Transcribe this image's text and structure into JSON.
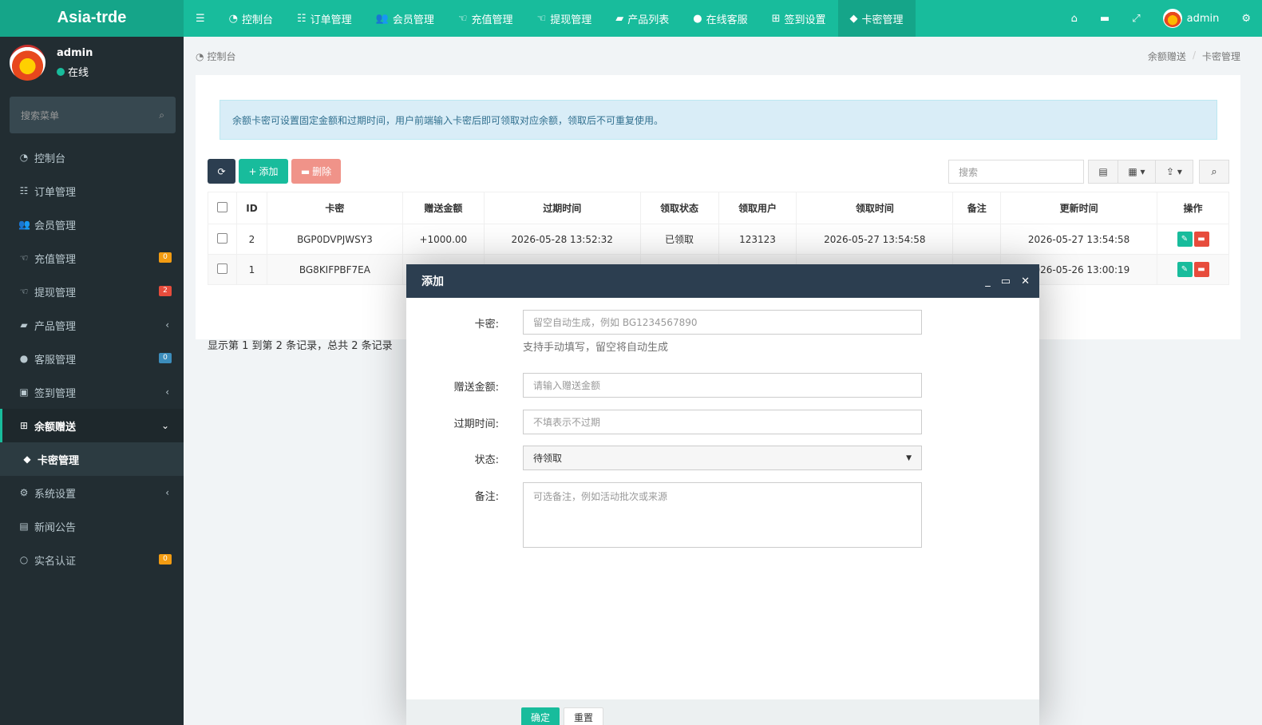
{
  "header": {
    "logo": "Asia-trde",
    "menu_icon": "bars-icon",
    "nav": [
      {
        "label": "控制台",
        "icon": "dashboard-icon"
      },
      {
        "label": "订单管理",
        "icon": "list-icon"
      },
      {
        "label": "会员管理",
        "icon": "users-icon"
      },
      {
        "label": "充值管理",
        "icon": "hand-icon"
      },
      {
        "label": "提现管理",
        "icon": "hand-icon"
      },
      {
        "label": "产品列表",
        "icon": "briefcase-icon"
      },
      {
        "label": "在线客服",
        "icon": "comment-icon"
      },
      {
        "label": "签到设置",
        "icon": "gift-icon"
      },
      {
        "label": "卡密管理",
        "icon": "tag-icon"
      }
    ],
    "right": {
      "username": "admin"
    }
  },
  "sidebar": {
    "user": {
      "name": "admin",
      "status": "在线"
    },
    "search_placeholder": "搜索菜单",
    "items": [
      {
        "label": "控制台",
        "icon": "dashboard-icon"
      },
      {
        "label": "订单管理",
        "icon": "list-icon"
      },
      {
        "label": "会员管理",
        "icon": "users-icon"
      },
      {
        "label": "充值管理",
        "icon": "hand-icon",
        "badge": "0",
        "badge_color": "#f39c12"
      },
      {
        "label": "提现管理",
        "icon": "hand-icon",
        "badge": "2",
        "badge_color": "#e74c3c"
      },
      {
        "label": "产品管理",
        "icon": "briefcase-icon",
        "arrow": "‹"
      },
      {
        "label": "客服管理",
        "icon": "comment-icon",
        "badge": "0",
        "badge_color": "#3c8dbc"
      },
      {
        "label": "签到管理",
        "icon": "calendar-icon",
        "arrow": "‹"
      },
      {
        "label": "余额赠送",
        "icon": "gift-icon",
        "arrow": "⌄"
      },
      {
        "label": "卡密管理",
        "icon": "tag-icon"
      },
      {
        "label": "系统设置",
        "icon": "cogs-icon",
        "arrow": "‹"
      },
      {
        "label": "新闻公告",
        "icon": "newspaper-icon"
      },
      {
        "label": "实名认证",
        "icon": "circle-icon",
        "badge": "0",
        "badge_color": "#f39c12"
      }
    ]
  },
  "breadcrumb": {
    "left": "控制台",
    "right": [
      "余额赠送",
      "/",
      "卡密管理"
    ]
  },
  "alert": "余额卡密可设置固定金额和过期时间，用户前端输入卡密后即可领取对应余额，领取后不可重复使用。",
  "toolbar": {
    "add": "添加",
    "delete": "删除",
    "search_placeholder": "搜索"
  },
  "table": {
    "headers": [
      "ID",
      "卡密",
      "赠送金额",
      "过期时间",
      "领取状态",
      "领取用户",
      "领取时间",
      "备注",
      "更新时间",
      "操作"
    ],
    "rows": [
      [
        "2",
        "BGP0DVPJWSY3",
        "+1000.00",
        "2026-05-28 13:52:32",
        "已领取",
        "123123",
        "2026-05-27 13:54:58",
        "",
        "2026-05-27 13:54:58"
      ],
      [
        "1",
        "BG8KIFPBF7EA",
        "",
        "",
        "",
        "",
        "",
        "",
        "2026-05-26 13:00:19"
      ]
    ]
  },
  "pagination": "显示第 1 到第 2 条记录，总共 2 条记录",
  "modal": {
    "title": "添加",
    "fields": {
      "card_label": "卡密:",
      "card_placeholder": "留空自动生成，例如 BG1234567890",
      "card_help": "支持手动填写，留空将自动生成",
      "amount_label": "赠送金额:",
      "amount_placeholder": "请输入赠送金额",
      "expire_label": "过期时间:",
      "expire_placeholder": "不填表示不过期",
      "status_label": "状态:",
      "status_value": "待领取",
      "remark_label": "备注:",
      "remark_placeholder": "可选备注，例如活动批次或来源"
    },
    "buttons": {
      "ok": "确定",
      "reset": "重置"
    }
  },
  "colors": {
    "primary": "#18bc9c",
    "dark": "#2c3e50",
    "sidebar": "#222d32",
    "danger": "#e74c3c"
  }
}
